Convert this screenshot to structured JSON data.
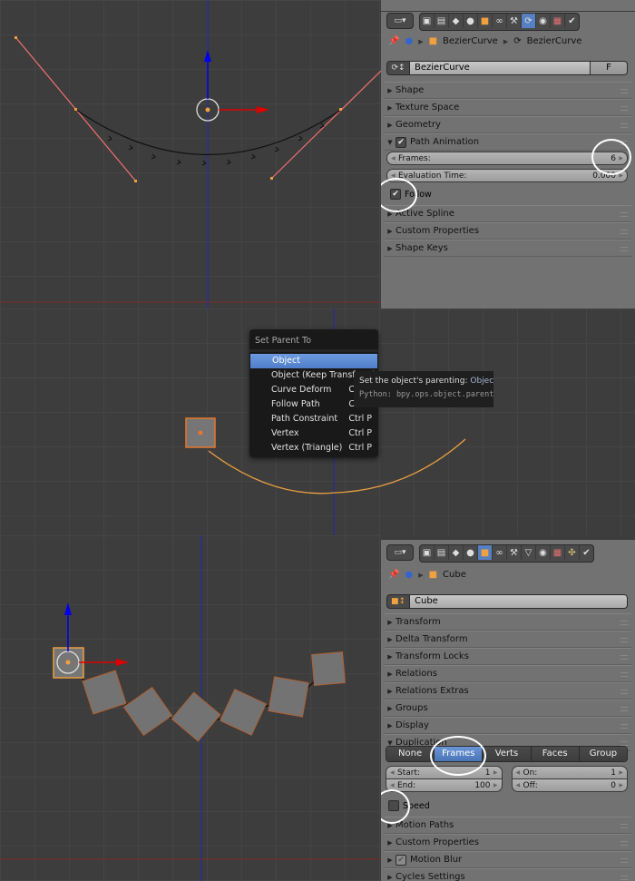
{
  "top_panel": {
    "viewport": {
      "name": "curve-edit-viewport"
    },
    "properties": {
      "context_tabs": [
        "render-icon",
        "render-layers-icon",
        "scene-icon",
        "world-icon",
        "object-icon",
        "constraints-icon",
        "modifiers-icon",
        "curve-data-icon",
        "material-icon",
        "texture-icon",
        "particles-icon"
      ],
      "active_tab": "curve-data-icon",
      "breadcrumb": [
        "BezierCurve",
        "BezierCurve"
      ],
      "datablock_name": "BezierCurve",
      "fake_user_label": "F",
      "panels_before": [
        "Shape",
        "Texture Space",
        "Geometry"
      ],
      "path_animation": {
        "label": "Path Animation",
        "enabled": true,
        "frames_label": "Frames:",
        "frames_value": "6",
        "eval_time_label": "Evaluation Time:",
        "eval_time_value": "0.000",
        "follow_label": "Follow",
        "follow_checked": true
      },
      "panels_after": [
        "Active Spline",
        "Custom Properties",
        "Shape Keys"
      ]
    }
  },
  "middle_panel": {
    "menu": {
      "title": "Set Parent To",
      "items": [
        {
          "label": "Object",
          "shortcut": ""
        },
        {
          "label": "Object (Keep Transform)",
          "shortcut": ""
        },
        {
          "label": "Curve Deform",
          "shortcut": "Ctrl P"
        },
        {
          "label": "Follow Path",
          "shortcut": "Ctrl P"
        },
        {
          "label": "Path Constraint",
          "shortcut": "Ctrl P"
        },
        {
          "label": "Vertex",
          "shortcut": "Ctrl P"
        },
        {
          "label": "Vertex (Triangle)",
          "shortcut": "Ctrl P"
        }
      ],
      "active_index": 0
    },
    "tooltip": {
      "description": "Set the object's parenting:",
      "value": "Object",
      "python": "Python: bpy.ops.object.parent_set"
    }
  },
  "bottom_panel": {
    "properties": {
      "active_tab": "object-icon",
      "breadcrumb": [
        "Cube"
      ],
      "datablock_name": "Cube",
      "panels_before": [
        "Transform",
        "Delta Transform",
        "Transform Locks",
        "Relations",
        "Relations Extras",
        "Groups",
        "Display"
      ],
      "duplication": {
        "label": "Duplication",
        "modes": [
          "None",
          "Frames",
          "Verts",
          "Faces",
          "Group"
        ],
        "active_mode": "Frames",
        "start_label": "Start:",
        "start_value": "1",
        "end_label": "End:",
        "end_value": "100",
        "on_label": "On:",
        "on_value": "1",
        "off_label": "Off:",
        "off_value": "0",
        "speed_label": "Speed",
        "speed_checked": false
      },
      "panels_after": [
        "Motion Paths",
        "Custom Properties"
      ],
      "motion_blur_label": "Motion Blur",
      "cycles_label": "Cycles Settings"
    }
  },
  "colors": {
    "accent_blue": "#5680c2",
    "selection_orange": "#e8872a",
    "handle_red": "#e06060",
    "x_axis": "#e00000",
    "z_axis": "#0000e0"
  }
}
